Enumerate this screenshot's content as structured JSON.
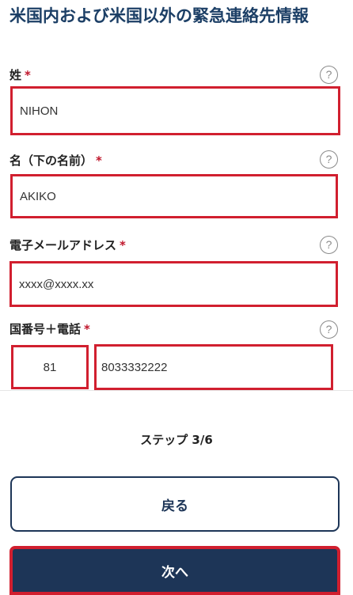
{
  "page_title": "米国内および米国以外の緊急連絡先情報",
  "required_mark": "*",
  "help_icon": "?",
  "fields": {
    "last_name": {
      "label": "姓",
      "value": "NIHON"
    },
    "first_name": {
      "label": "名（下の名前）",
      "value": "AKIKO"
    },
    "email": {
      "label": "電子メールアドレス",
      "value": "xxxx@xxxx.xx"
    },
    "phone": {
      "label": "国番号＋電話",
      "country_code": "81",
      "number": "8033332222"
    }
  },
  "step_text": "ステップ 3/6",
  "buttons": {
    "back": "戻る",
    "next": "次へ"
  },
  "colors": {
    "brand": "#1d3557",
    "title": "#1c3f66",
    "required": "#c0162b",
    "highlight": "#d11f2f"
  }
}
